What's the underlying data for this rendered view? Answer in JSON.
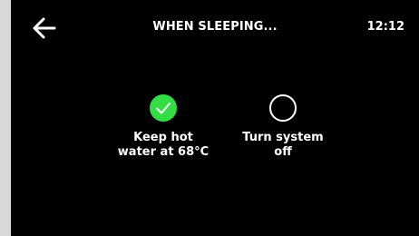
{
  "header": {
    "title": "WHEN SLEEPING...",
    "time": "12:12",
    "back_icon": "arrow-left-icon"
  },
  "options": [
    {
      "label_line1": "Keep hot",
      "label_line2": "water at 68°C",
      "selected": true
    },
    {
      "label_line1": "Turn system",
      "label_line2": "off",
      "selected": false
    }
  ],
  "colors": {
    "background": "#000000",
    "text": "#ffffff",
    "accent_selected": "#33dd44",
    "outer_frame": "#d9d9d9"
  }
}
